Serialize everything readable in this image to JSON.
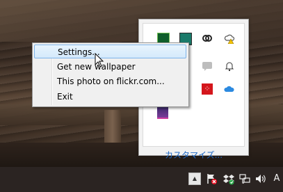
{
  "context_menu": {
    "items": [
      {
        "label": "Settings..."
      },
      {
        "label": "Get new wallpaper"
      },
      {
        "label": "This photo on flickr.com..."
      },
      {
        "label": "Exit"
      }
    ]
  },
  "tray_flyout": {
    "customize_label": "カスタマイズ...",
    "icons": [
      "nvidia-icon",
      "app-icon",
      "creative-cloud-icon",
      "cloud-warning-icon",
      "chat-icon",
      "bell-icon",
      "acrobat-icon",
      "onedrive-icon",
      "wallpaper-app-icon"
    ]
  },
  "taskbar": {
    "ime_label": "A",
    "icons": [
      "show-hidden-icons-chevron",
      "action-center-flag-icon",
      "dropbox-icon",
      "network-icon",
      "volume-icon"
    ]
  },
  "colors": {
    "menu_highlight_border": "#7eb4ea",
    "link_blue": "#1e68c5",
    "taskbar_bg": "#2b2422"
  }
}
